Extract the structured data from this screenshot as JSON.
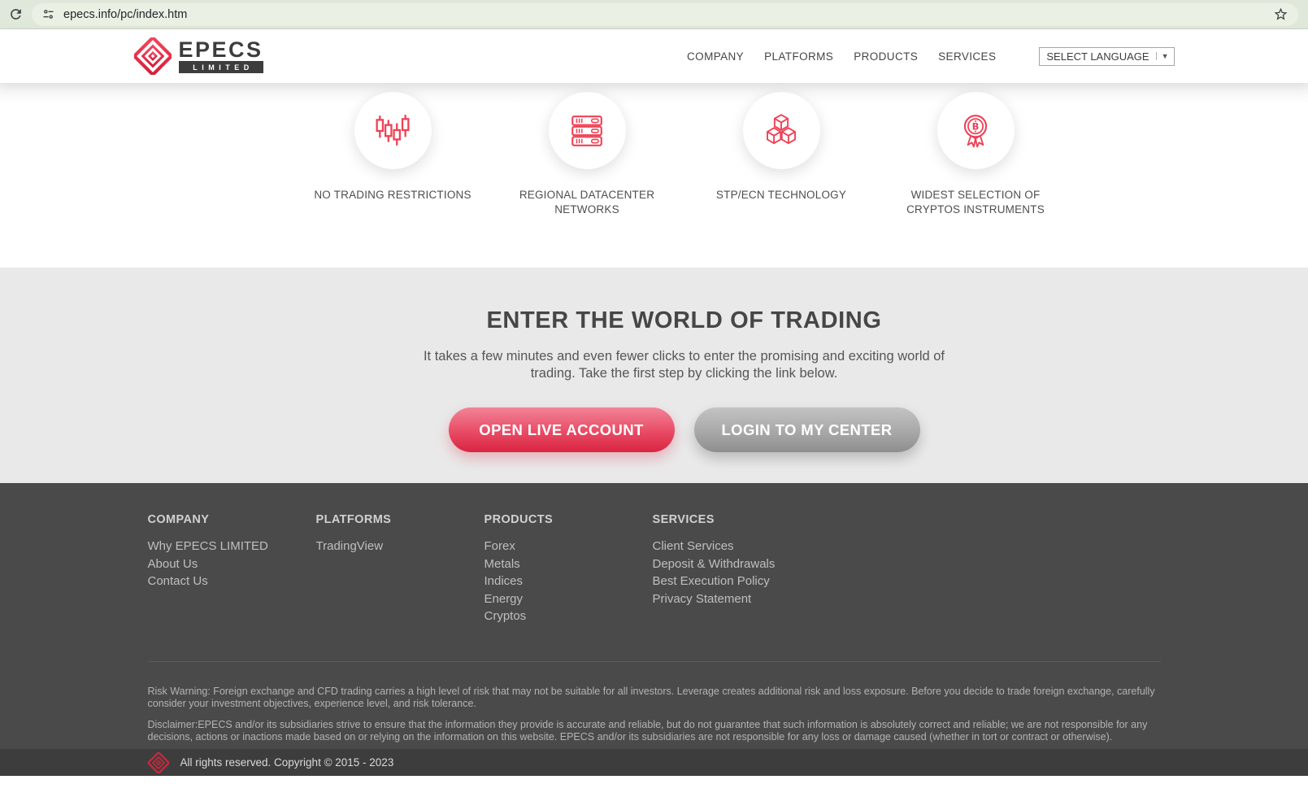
{
  "browser": {
    "url": "epecs.info/pc/index.htm"
  },
  "header": {
    "logo_title": "EPECS",
    "logo_subtitle": "LIMITED",
    "nav": [
      {
        "label": "COMPANY"
      },
      {
        "label": "PLATFORMS"
      },
      {
        "label": "PRODUCTS"
      },
      {
        "label": "SERVICES"
      }
    ],
    "language_selector": {
      "label": "SELECT LANGUAGE",
      "arrow": "▼"
    }
  },
  "features": [
    {
      "icon": "candlestick-chart-icon",
      "label": "NO TRADING RESTRICTIONS"
    },
    {
      "icon": "server-rack-icon",
      "label": "REGIONAL DATACENTER NETWORKS"
    },
    {
      "icon": "cubes-icon",
      "label": "STP/ECN TECHNOLOGY"
    },
    {
      "icon": "award-bitcoin-icon",
      "label": "WIDEST SELECTION OF CRYPTOS INSTRUMENTS"
    }
  ],
  "cta": {
    "title": "ENTER THE WORLD OF TRADING",
    "description": "It takes a few minutes and even fewer clicks to enter the promising and exciting world of trading. Take the first step by clicking the link below.",
    "primary_button": "OPEN LIVE ACCOUNT",
    "secondary_button": "LOGIN TO MY CENTER"
  },
  "footer": {
    "columns": [
      {
        "title": "COMPANY",
        "links": [
          "Why EPECS LIMITED",
          "About Us",
          "Contact Us"
        ]
      },
      {
        "title": "PLATFORMS",
        "links": [
          "TradingView"
        ]
      },
      {
        "title": "PRODUCTS",
        "links": [
          "Forex",
          "Metals",
          "Indices",
          "Energy",
          "Cryptos"
        ]
      },
      {
        "title": "SERVICES",
        "links": [
          "Client Services",
          "Deposit & Withdrawals",
          "Best Execution Policy",
          "Privacy Statement"
        ]
      }
    ],
    "risk_warning": "Risk Warning: Foreign exchange and CFD trading carries a high level of risk that may not be suitable for all investors. Leverage creates additional risk and loss exposure. Before you decide to trade foreign exchange, carefully consider your investment objectives, experience level, and risk tolerance.",
    "disclaimer": "Disclaimer:EPECS and/or its subsidiaries strive to ensure that the information they provide is accurate and reliable, but do not guarantee that such information is absolutely correct and reliable; we are not responsible for any decisions, actions or inactions made based on or relying on the information on this website. EPECS and/or its subsidiaries are not responsible for any loss or damage caused (whether in tort or contract or otherwise).",
    "copyright": "All rights reserved. Copyright © 2015 - 2023"
  },
  "colors": {
    "accent_red": "#e93b4f",
    "toolbar_bg": "#dfe8da",
    "cta_bg": "#e9e9e9",
    "footer_bg": "#4a4a4a",
    "bottom_bar_bg": "#3d3d3d"
  }
}
